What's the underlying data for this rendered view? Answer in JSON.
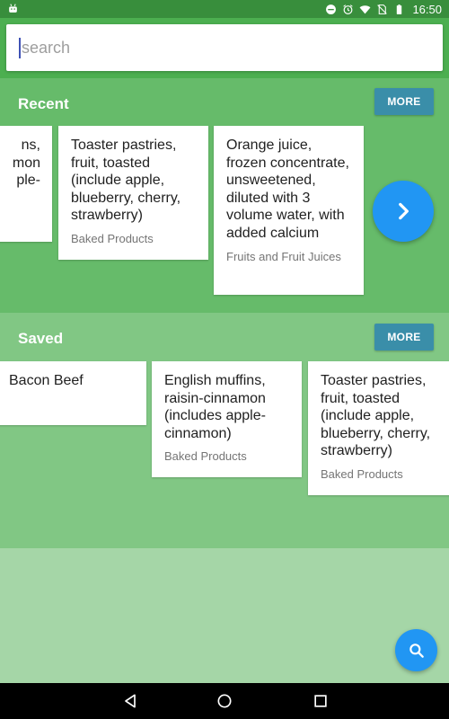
{
  "status_bar": {
    "time": "16:50",
    "icons": [
      "android-icon",
      "minus-circle-icon",
      "alarm-icon",
      "wifi-icon",
      "no-sim-icon",
      "battery-icon"
    ]
  },
  "search": {
    "placeholder": "search",
    "value": ""
  },
  "recent": {
    "title": "Recent",
    "more_label": "MORE",
    "items": [
      {
        "name": "ns,\nmon\nple-",
        "category": ""
      },
      {
        "name": "Toaster pastries, fruit, toasted (include apple, blueberry, cherry, strawberry)",
        "category": "Baked Products"
      },
      {
        "name": "Orange juice, frozen concentrate, unsweetened, diluted with 3 volume water, with added calcium",
        "category": "Fruits and Fruit Juices"
      }
    ]
  },
  "saved": {
    "title": "Saved",
    "more_label": "MORE",
    "items": [
      {
        "name": "Bacon Beef",
        "category": ""
      },
      {
        "name": "English muffins, raisin-cinnamon (includes apple-cinnamon)",
        "category": "Baked Products"
      },
      {
        "name": "Toaster pastries, fruit, toasted (include apple, blueberry, cherry, strawberry)",
        "category": "Baked Products"
      }
    ]
  },
  "colors": {
    "status_bar": "#388e3c",
    "search_area": "#4caf50",
    "recent_bg": "#66bb6a",
    "saved_bg": "#81c784",
    "empty_bg": "#a5d6a7",
    "more_button": "#3a8ea9",
    "fab": "#2196f3"
  }
}
